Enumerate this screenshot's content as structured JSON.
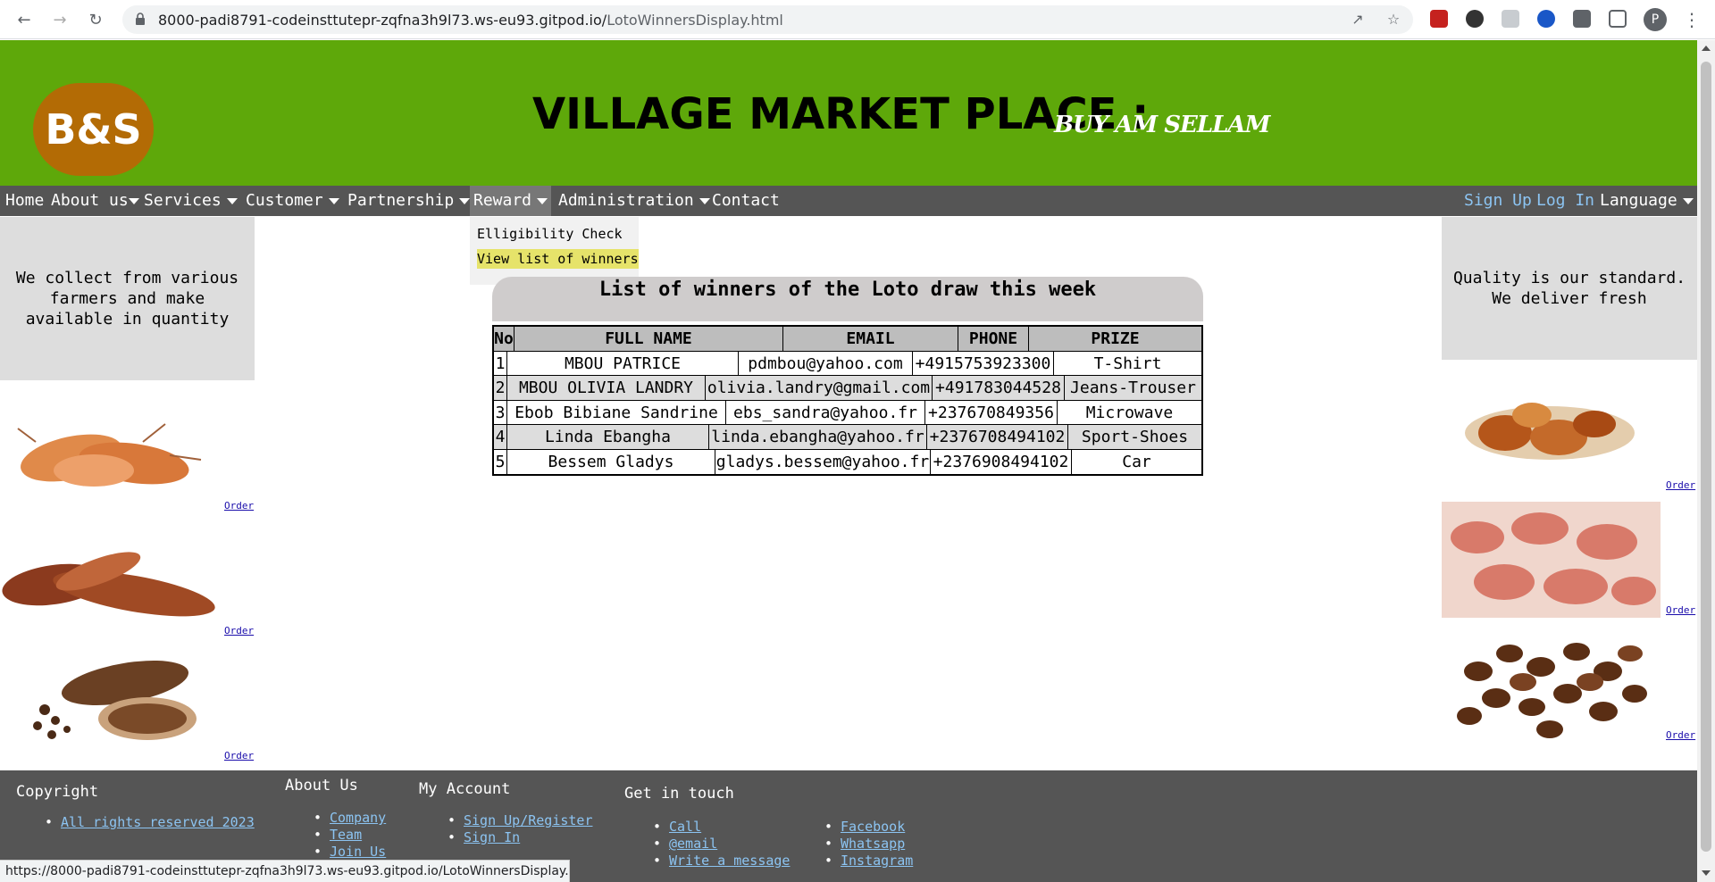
{
  "browser": {
    "url_host": "8000-padi8791-codeinsttutepr-zqfna3h9l73.ws-eu93.gitpod.io/",
    "url_path": "LotoWinnersDisplay.html",
    "profile_initial": "P",
    "status_url": "https://8000-padi8791-codeinsttutepr-zqfna3h9l73.ws-eu93.gitpod.io/LotoWinnersDisplay.ht..."
  },
  "header": {
    "logo": "B&S",
    "title": "VILLAGE MARKET PLACE :",
    "slogan": "BUY AM SELLAM",
    "bg_color": "#5ea80a",
    "logo_color": "#b36b05"
  },
  "nav": {
    "home": "Home",
    "about": "About us",
    "services": "Services",
    "customer": "Customer",
    "partnership": "Partnership",
    "reward": "Reward",
    "administration": "Administration",
    "contact": "Contact",
    "signup": "Sign Up",
    "login": "Log In",
    "language": "Language"
  },
  "reward_menu": {
    "item1": "Elligibility Check",
    "item2": "View list of winners"
  },
  "left": {
    "text": "We collect from various farmers and make available in quantity",
    "order": "Order",
    "images": [
      "sweet-potato-image",
      "yam-image",
      "cocoa-pod-image"
    ]
  },
  "right": {
    "text": "Quality is our standard. We deliver fresh",
    "order": "Order",
    "images": [
      "kola-nut-image",
      "peanuts-image",
      "coffee-beans-image"
    ]
  },
  "winners": {
    "title": "List of winners of the Loto draw this week",
    "headers": {
      "no": "No",
      "name": "FULL NAME",
      "email": "EMAIL",
      "phone": "PHONE",
      "prize": "PRIZE"
    },
    "rows": [
      {
        "no": "1",
        "name": "MBOU PATRICE",
        "email": "pdmbou@yahoo.com",
        "phone": "+4915753923300",
        "prize": "T-Shirt"
      },
      {
        "no": "2",
        "name": "MBOU OLIVIA LANDRY",
        "email": "olivia.landry@gmail.com",
        "phone": "+491783044528",
        "prize": "Jeans-Trouser"
      },
      {
        "no": "3",
        "name": "Ebob Bibiane Sandrine",
        "email": "ebs_sandra@yahoo.fr",
        "phone": "+237670849356",
        "prize": "Microwave"
      },
      {
        "no": "4",
        "name": "Linda Ebangha",
        "email": "linda.ebangha@yahoo.fr",
        "phone": "+2376708494102",
        "prize": "Sport-Shoes"
      },
      {
        "no": "5",
        "name": "Bessem Gladys",
        "email": "gladys.bessem@yahoo.fr",
        "phone": "+2376908494102",
        "prize": "Car"
      }
    ]
  },
  "footer": {
    "copyright_heading": "Copyright",
    "copyright_link": "All rights reserved 2023",
    "about_heading": "About Us",
    "about_links": [
      "Company",
      "Team",
      "Join Us"
    ],
    "account_heading": "My Account",
    "account_links": [
      "Sign Up/Register",
      "Sign In"
    ],
    "touch_heading": "Get in touch",
    "touch_links": [
      "Call",
      "@email",
      "Write a message"
    ],
    "social_links": [
      "Facebook",
      "Whatsapp",
      "Instagram"
    ]
  }
}
